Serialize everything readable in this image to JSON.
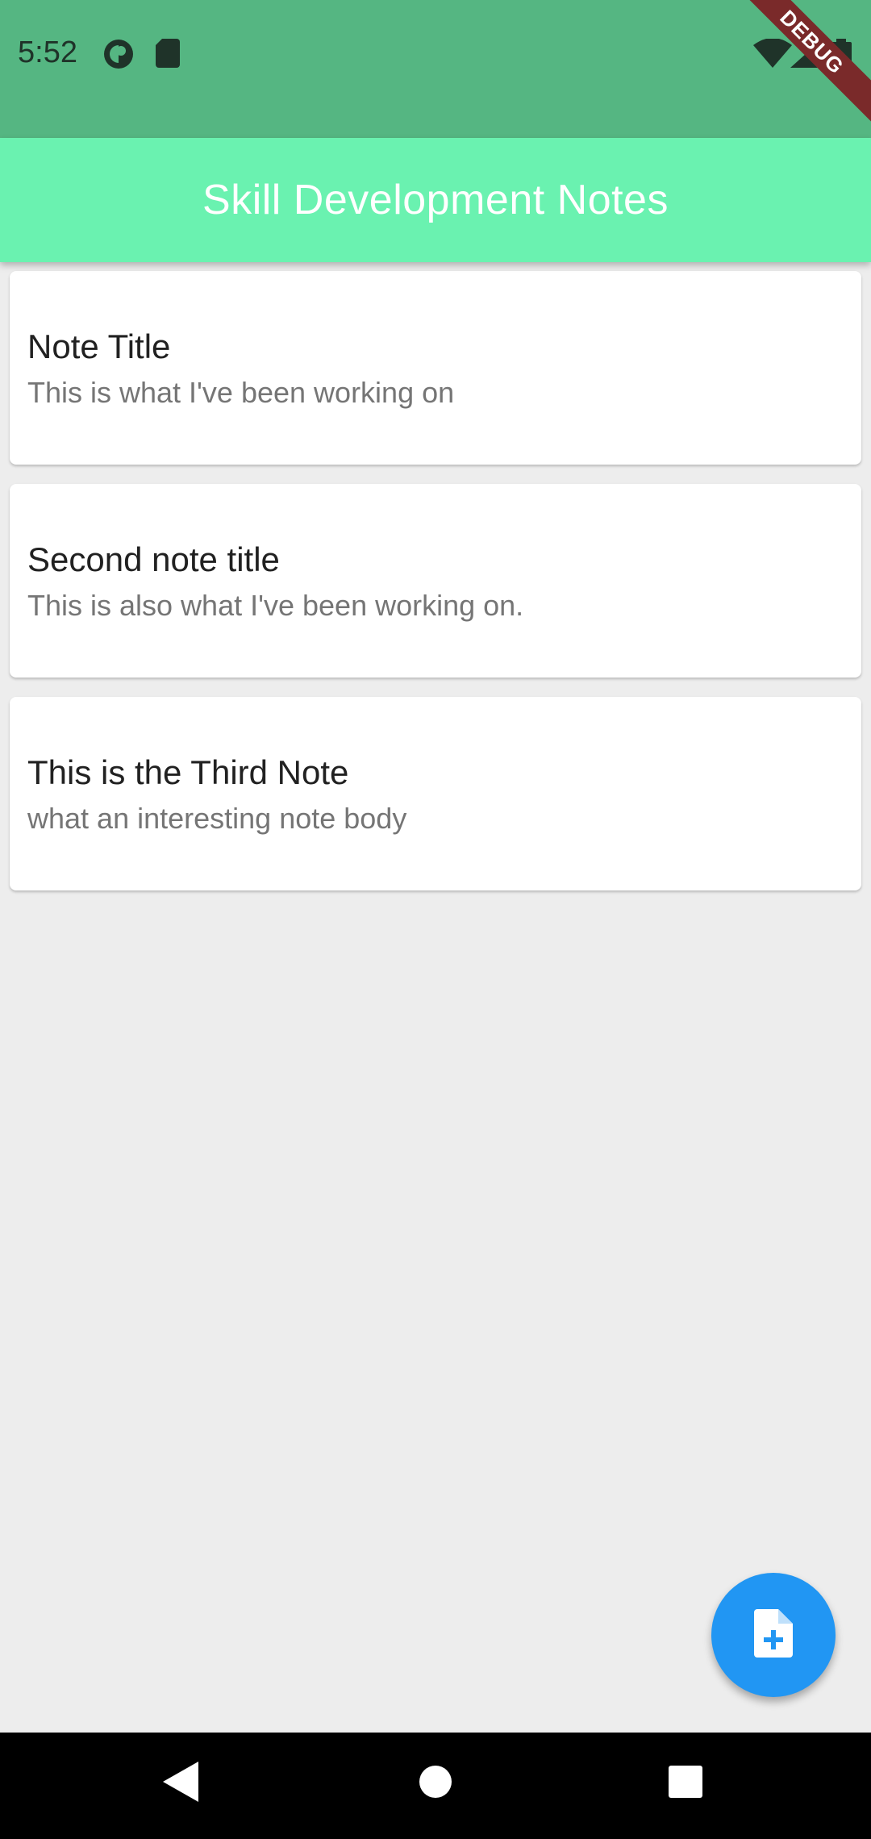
{
  "status_bar": {
    "time": "5:52",
    "icons": [
      "circle-app-icon",
      "sd-card-icon",
      "wifi-icon",
      "signal-icon",
      "battery-icon"
    ]
  },
  "app_bar": {
    "title": "Skill Development Notes"
  },
  "debug_banner": {
    "label": "DEBUG"
  },
  "notes": [
    {
      "title": "Note Title",
      "body": "This is what I've been working on"
    },
    {
      "title": "Second note title",
      "body": "This is also what I've been working on."
    },
    {
      "title": "This is the Third Note",
      "body": "what an interesting note body"
    }
  ],
  "fab": {
    "icon": "add-note-icon"
  },
  "nav_bar": {
    "icons": [
      "back-icon",
      "home-icon",
      "recents-icon"
    ]
  },
  "colors": {
    "status_bar": "#55b682",
    "app_bar": "#6af2b0",
    "fab": "#2196f3",
    "background": "#ededed"
  }
}
